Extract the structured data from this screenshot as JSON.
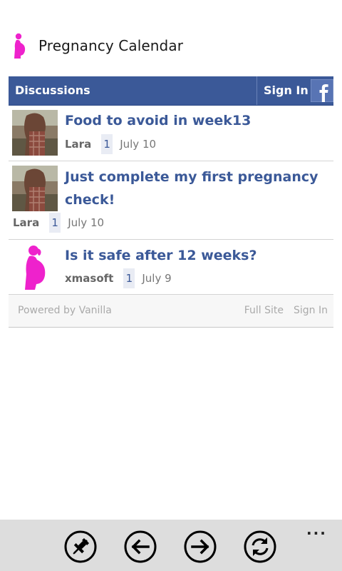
{
  "app": {
    "title": "Pregnancy Calendar",
    "accent": "#ee22cc"
  },
  "forum": {
    "header_title": "Discussions",
    "sign_in": "Sign In",
    "brand_color": "#3b5998",
    "discussions": [
      {
        "title": "Food to avoid in week13",
        "author": "Lara",
        "comments": "1",
        "date": "July 10"
      },
      {
        "title_line1": "Just complete my first pregnancy",
        "title_line2": "check!",
        "author": "Lara",
        "comments": "1",
        "date": "July 10"
      },
      {
        "title": "Is it safe after 12 weeks?",
        "author": "xmasoft",
        "comments": "1",
        "date": "July 9"
      }
    ],
    "footer": {
      "powered": "Powered by Vanilla",
      "full_site": "Full Site",
      "sign_in": "Sign In"
    }
  },
  "appbar": {
    "buttons": [
      "pin-icon",
      "back-arrow-icon",
      "forward-arrow-icon",
      "refresh-icon"
    ],
    "more": "..."
  }
}
